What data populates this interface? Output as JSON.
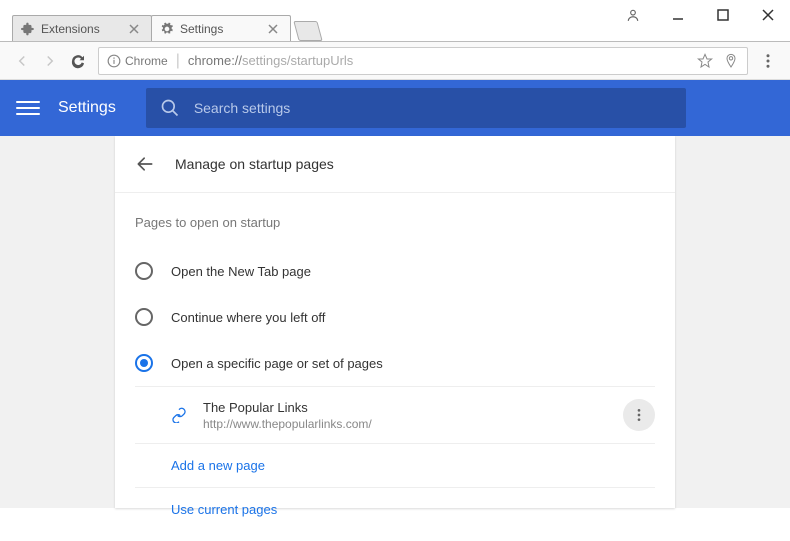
{
  "window": {
    "tabs": [
      {
        "label": "Extensions",
        "active": false
      },
      {
        "label": "Settings",
        "active": true
      }
    ]
  },
  "omnibox": {
    "origin_label": "Chrome",
    "url_prefix": "chrome://",
    "url_path": "settings/startupUrls"
  },
  "header": {
    "title": "Settings",
    "search_placeholder": "Search settings"
  },
  "page": {
    "title": "Manage on startup pages",
    "section_label": "Pages to open on startup",
    "options": [
      {
        "label": "Open the New Tab page",
        "checked": false
      },
      {
        "label": "Continue where you left off",
        "checked": false
      },
      {
        "label": "Open a specific page or set of pages",
        "checked": true
      }
    ],
    "startup_pages": [
      {
        "name": "The Popular Links",
        "url": "http://www.thepopularlinks.com/"
      }
    ],
    "add_page_label": "Add a new page",
    "use_current_label": "Use current pages"
  }
}
